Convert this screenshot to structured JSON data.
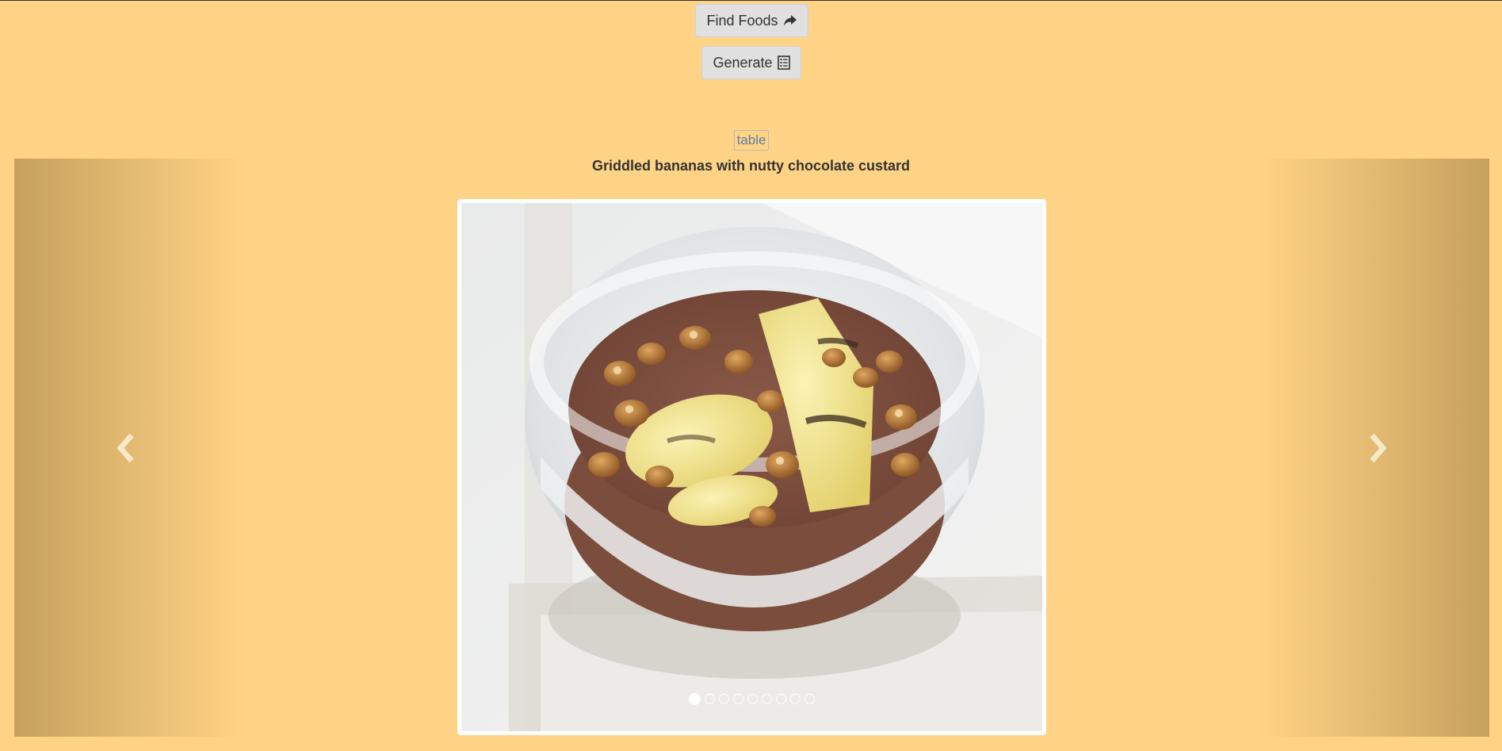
{
  "toolbar": {
    "find_foods_label": "Find Foods",
    "find_foods_icon": "share-arrow-icon",
    "generate_label": "Generate",
    "generate_icon": "list-alt-icon"
  },
  "content": {
    "table_link_label": "table",
    "dish_title": "Griddled bananas with nutty chocolate custard"
  },
  "carousel": {
    "prev_icon": "chevron-left-icon",
    "next_icon": "chevron-right-icon",
    "image_description_icon": "dessert-photo",
    "slide_count": 9,
    "active_index": 0
  },
  "colors": {
    "background": "#ffd385",
    "button": "#e0e0e0",
    "link": "#5a7fa8"
  }
}
